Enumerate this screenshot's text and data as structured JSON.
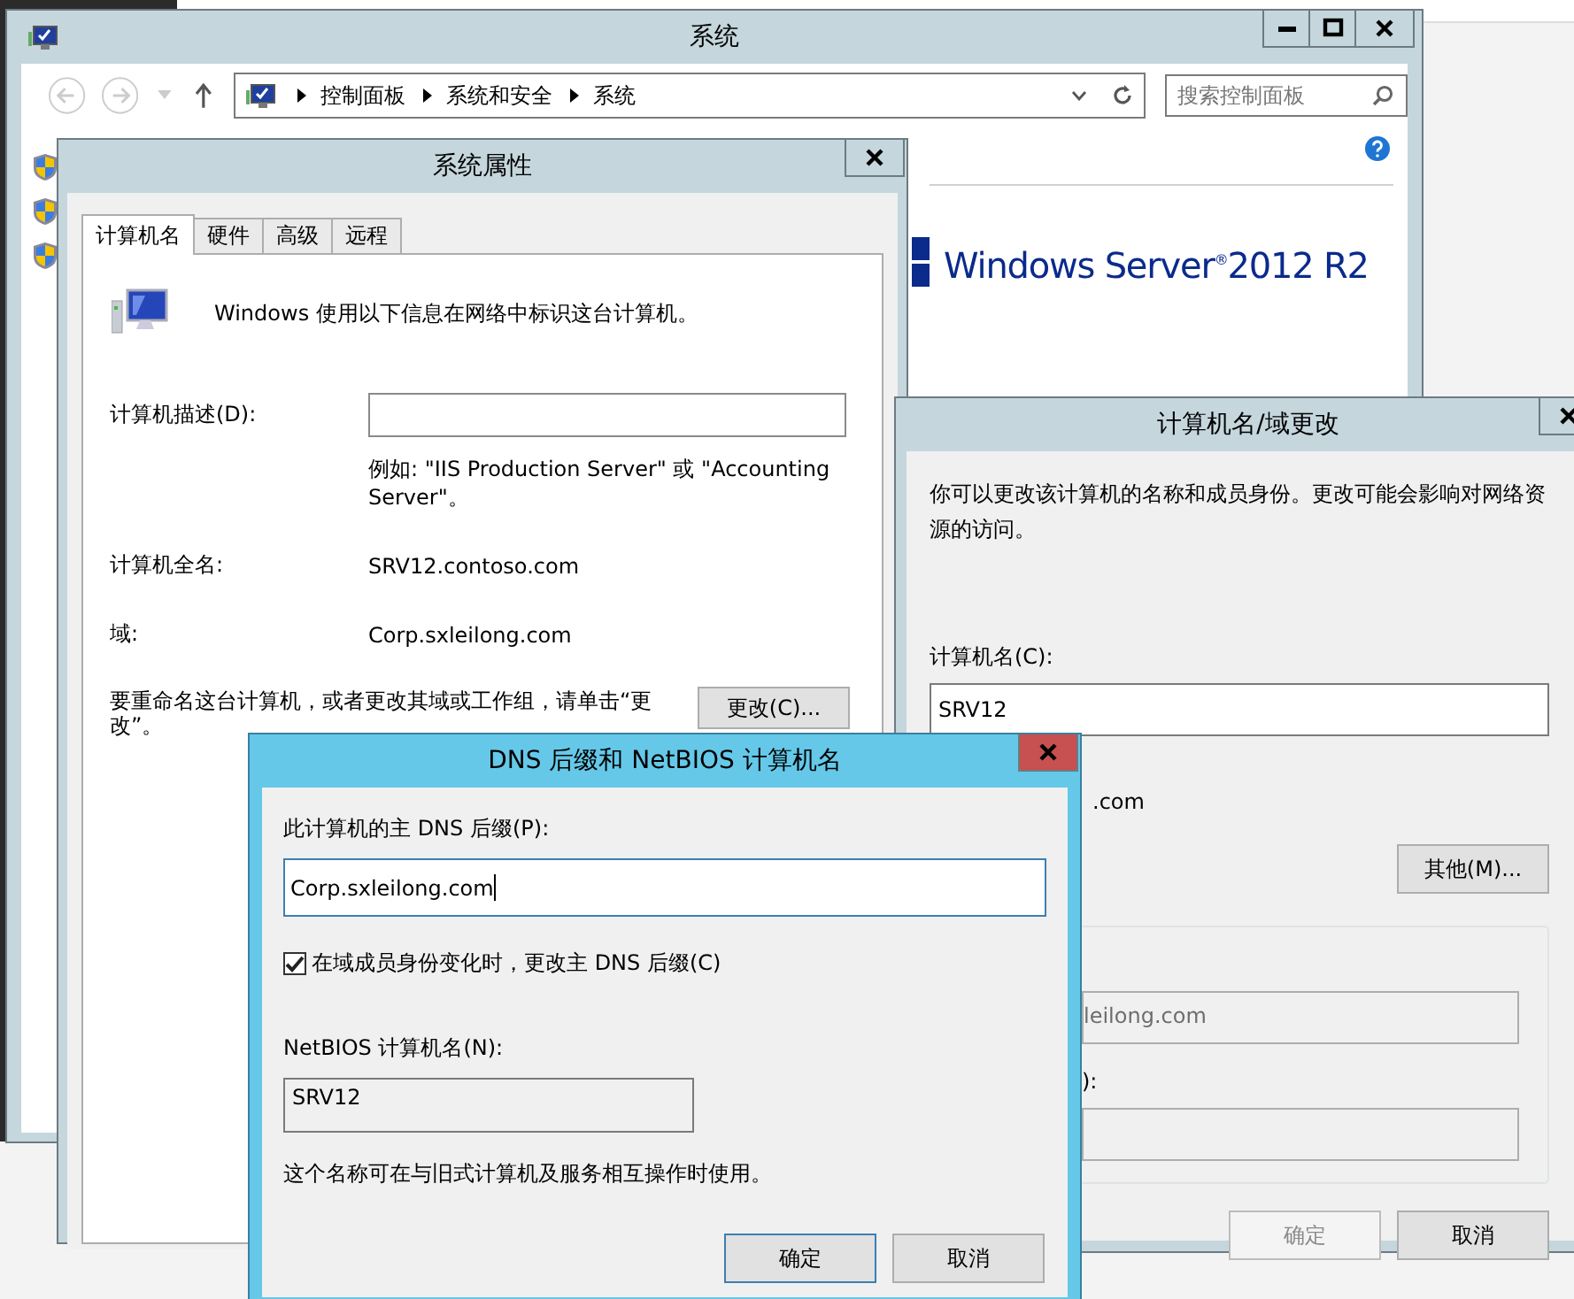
{
  "system_window": {
    "title": "系统",
    "breadcrumb": [
      "控制面板",
      "系统和安全",
      "系统"
    ],
    "search": {
      "placeholder": "搜索控制面板"
    },
    "logo": "Windows Server$^{®}$2012 R2",
    "nav_items": [
      {
        "kind": "shield"
      },
      {
        "kind": "shield"
      },
      {
        "kind": "shield"
      }
    ]
  },
  "system_properties": {
    "title": "系统属性",
    "tabs": [
      {
        "label": "计算机名",
        "selected": true
      },
      {
        "label": "硬件",
        "selected": false
      },
      {
        "label": "高级",
        "selected": false
      },
      {
        "label": "远程",
        "selected": false
      }
    ],
    "intro": "Windows 使用以下信息在网络中标识这台计算机。",
    "description_label": "计算机描述(D):",
    "description_hint": "例如: \"IIS Production Server\" 或 \"Accounting Server\"。",
    "full_name_label": "计算机全名:",
    "full_name": "SRV12.contoso.com",
    "domain_label": "域:",
    "domain": "Corp.sxleilong.com",
    "rename_text": "要重命名这台计算机，或者更改其域或工作组，请单击“更改”。",
    "change_button": "更改(C)..."
  },
  "domain_change": {
    "title": "计算机名/域更改",
    "intro": "你可以更改该计算机的名称和成员身份。更改可能会影响对网络资源的访问。",
    "name_label": "计算机名(C):",
    "name_value": "SRV12",
    "full_name_tail": ".com",
    "more_button": "其他(M)...",
    "domain_value_tail": "leilong.com",
    "workgroup_label_tail": "):",
    "buttons": [
      {
        "label": "确定",
        "disabled": true
      },
      {
        "label": "取消",
        "disabled": false
      }
    ]
  },
  "dns_dialog": {
    "title": "DNS 后缀和 NetBIOS 计算机名",
    "suffix_label": "此计算机的主 DNS 后缀(P):",
    "suffix_value": "Corp.sxleilong.com",
    "checkbox": {
      "label": "在域成员身份变化时，更改主 DNS 后缀(C)",
      "checked": true
    },
    "netbios_label": "NetBIOS 计算机名(N):",
    "netbios_value": "SRV12",
    "note": "这个名称可在与旧式计算机及服务相互操作时使用。",
    "buttons": [
      {
        "label": "确定",
        "default": true
      },
      {
        "label": "取消",
        "default": false
      }
    ]
  }
}
